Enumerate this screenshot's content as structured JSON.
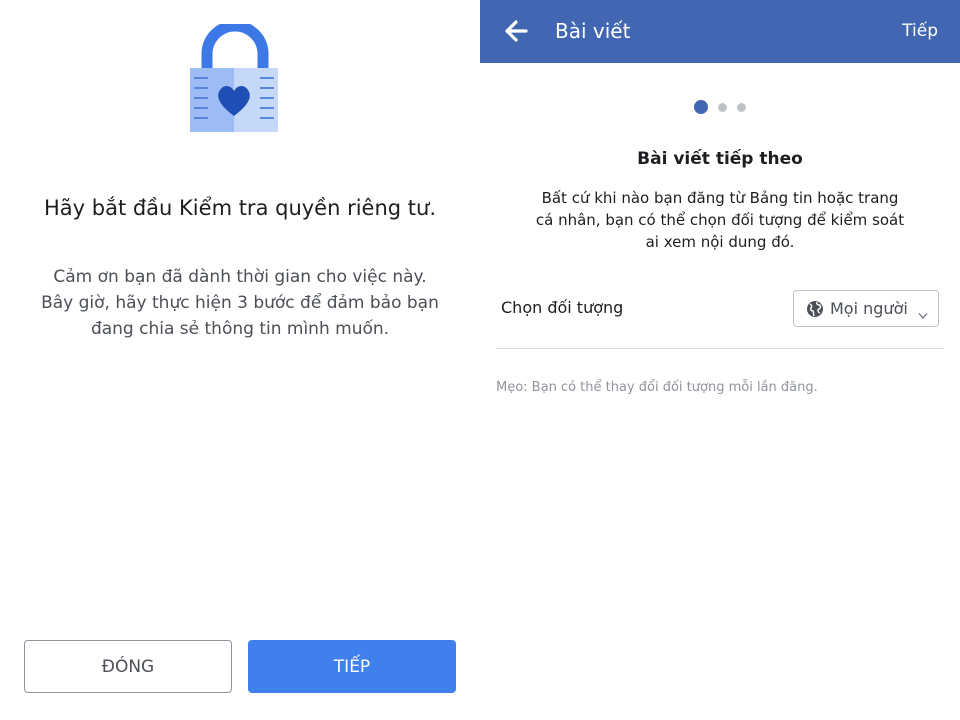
{
  "left_screen": {
    "icon": "lock-heart-icon",
    "headline": "Hãy bắt đầu Kiểm tra quyền riêng tư.",
    "body_lines": [
      "Cảm ơn bạn đã dành thời gian cho việc này.",
      "Bây giờ, hãy thực hiện 3 bước để đảm bảo bạn",
      "đang chia sẻ thông tin mình muốn."
    ],
    "close_label": "ĐÓNG",
    "next_label": "TIẾP"
  },
  "right_screen": {
    "header": {
      "back_icon": "back-arrow-icon",
      "title": "Bài viết",
      "next_label": "Tiếp"
    },
    "steps": {
      "total": 3,
      "current": 1
    },
    "section_title": "Bài viết tiếp theo",
    "description_lines": [
      "Bất cứ khi nào bạn đăng từ Bảng tin hoặc trang",
      "cá nhân, bạn có thể chọn đối tượng để kiểm soát",
      "ai xem nội dung đó."
    ],
    "audience": {
      "label": "Chọn đối tượng",
      "icon": "globe-icon",
      "selected": "Mọi người"
    },
    "tip": "Mẹo: Bạn có thể thay đổi đối tượng mỗi lần đăng."
  },
  "colors": {
    "header_blue": "#4267b2",
    "button_blue": "#4080ec",
    "lock_blue": "#6f9cf0",
    "heart_blue": "#1f4fb5"
  }
}
